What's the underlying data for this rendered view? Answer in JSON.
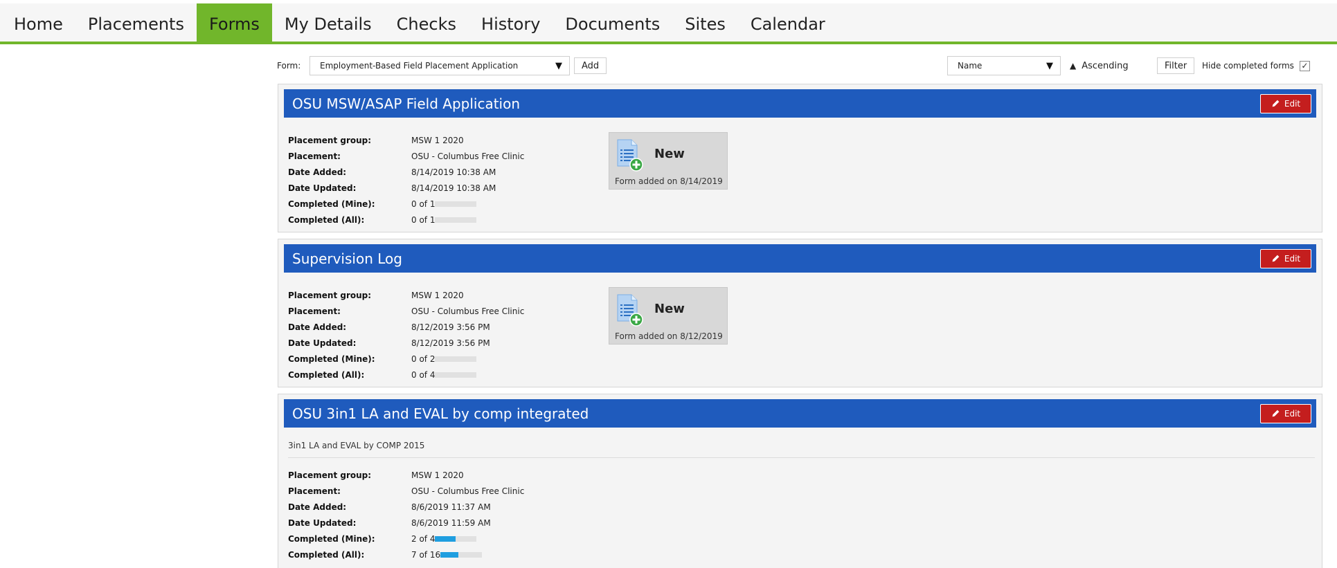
{
  "nav": {
    "tabs": [
      {
        "label": "Home"
      },
      {
        "label": "Placements"
      },
      {
        "label": "Forms"
      },
      {
        "label": "My Details"
      },
      {
        "label": "Checks"
      },
      {
        "label": "History"
      },
      {
        "label": "Documents"
      },
      {
        "label": "Sites"
      },
      {
        "label": "Calendar"
      }
    ],
    "active": "Forms"
  },
  "toolbar": {
    "form_label": "Form:",
    "form_selected": "Employment-Based Field Placement Application",
    "add_label": "Add",
    "sort_selected": "Name",
    "order_label": "Ascending",
    "filter_label": "Filter",
    "hide_completed_label": "Hide completed forms",
    "hide_completed_checked": true
  },
  "labels": {
    "placement_group": "Placement group:",
    "placement": "Placement:",
    "date_added": "Date Added:",
    "date_updated": "Date Updated:",
    "completed_mine": "Completed (Mine):",
    "completed_all": "Completed (All):",
    "edit": "Edit",
    "new": "New"
  },
  "forms": [
    {
      "title": "OSU MSW/ASAP Field Application",
      "placement_group": "MSW 1 2020",
      "placement": "OSU - Columbus Free Clinic",
      "date_added": "8/14/2019 10:38 AM",
      "date_updated": "8/14/2019 10:38 AM",
      "completed_mine": "0 of 1",
      "completed_mine_fraction": 0,
      "completed_all": "0 of 1",
      "completed_all_fraction": 0,
      "new_tile_text": "Form added on 8/14/2019"
    },
    {
      "title": "Supervision Log",
      "placement_group": "MSW 1 2020",
      "placement": "OSU - Columbus Free Clinic",
      "date_added": "8/12/2019 3:56 PM",
      "date_updated": "8/12/2019 3:56 PM",
      "completed_mine": "0 of 2",
      "completed_mine_fraction": 0,
      "completed_all": "0 of 4",
      "completed_all_fraction": 0,
      "new_tile_text": "Form added on 8/12/2019"
    },
    {
      "title": "OSU 3in1 LA and EVAL by comp integrated",
      "description": "3in1 LA and EVAL by COMP 2015",
      "placement_group": "MSW 1 2020",
      "placement": "OSU - Columbus Free Clinic",
      "date_added": "8/6/2019 11:37 AM",
      "date_updated": "8/6/2019 11:59 AM",
      "completed_mine": "2 of 4",
      "completed_mine_fraction": 0.5,
      "completed_all": "7 of 16",
      "completed_all_fraction": 0.4375
    }
  ],
  "colors": {
    "nav_accent": "#71b62b",
    "card_header": "#1f5bbd",
    "edit_button": "#c41e1e",
    "progress_fill": "#1f9ee0"
  }
}
